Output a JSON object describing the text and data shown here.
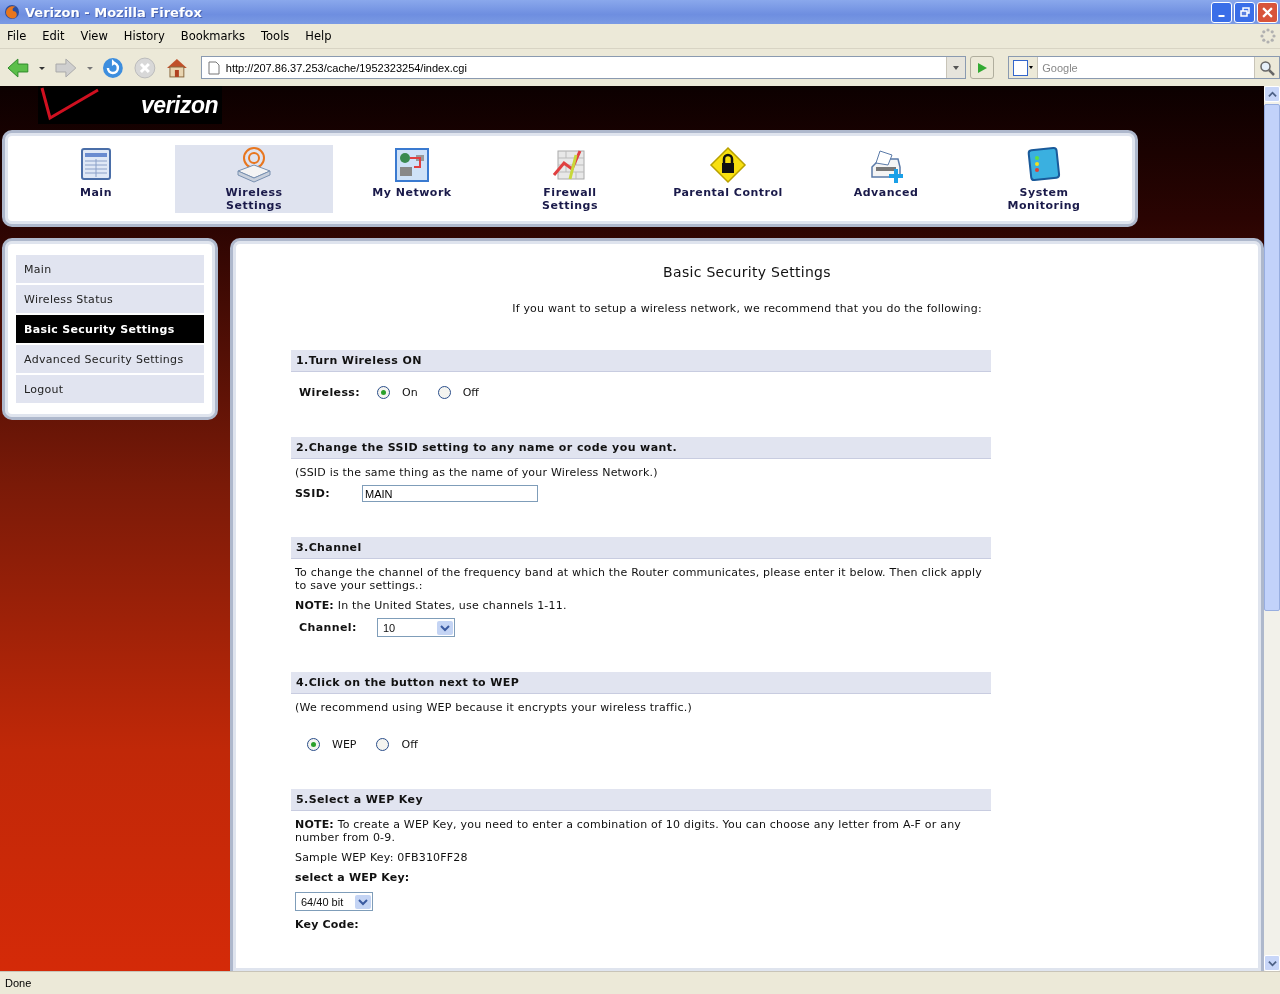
{
  "window": {
    "title": "Verizon - Mozilla Firefox"
  },
  "menu": [
    "File",
    "Edit",
    "View",
    "History",
    "Bookmarks",
    "Tools",
    "Help"
  ],
  "toolbar": {
    "url": "http://207.86.37.253/cache/1952323254/index.cgi",
    "search_placeholder": "Google"
  },
  "logo": {
    "text": "verizon"
  },
  "nav": [
    {
      "label": "Main",
      "selected": false
    },
    {
      "label": "Wireless Settings",
      "selected": true
    },
    {
      "label": "My Network",
      "selected": false
    },
    {
      "label": "Firewall Settings",
      "selected": false
    },
    {
      "label": "Parental Control",
      "selected": false
    },
    {
      "label": "Advanced",
      "selected": false
    },
    {
      "label": "System Monitoring",
      "selected": false
    }
  ],
  "sidebar": [
    {
      "label": "Main",
      "selected": false
    },
    {
      "label": "Wireless Status",
      "selected": false
    },
    {
      "label": "Basic Security Settings",
      "selected": true
    },
    {
      "label": "Advanced Security Settings",
      "selected": false
    },
    {
      "label": "Logout",
      "selected": false
    }
  ],
  "main": {
    "title": "Basic Security Settings",
    "intro": "If you want to setup a wireless network, we recommend that you do the following:",
    "sections": [
      {
        "heading": "1.Turn Wireless ON",
        "items": [
          {
            "kind": "radio_group",
            "label": "Wireless:",
            "options": [
              {
                "label": "On",
                "selected": true
              },
              {
                "label": "Off",
                "selected": false
              }
            ]
          }
        ]
      },
      {
        "heading": "2.Change the SSID setting to any name or code you want.",
        "items": [
          {
            "kind": "text",
            "text": "(SSID is the same thing as the name of your Wireless Network.)"
          },
          {
            "kind": "field",
            "label": "SSID:",
            "value": "MAIN"
          }
        ]
      },
      {
        "heading": "3.Channel",
        "items": [
          {
            "kind": "text",
            "text": "To change the channel of the frequency band at which the Router communicates, please enter it below. Then click apply to save your settings.:"
          },
          {
            "kind": "text",
            "text": "**NOTE:** In the United States, use channels 1-11."
          },
          {
            "kind": "select",
            "label": "Channel:",
            "value": "10"
          }
        ]
      },
      {
        "heading": "4.Click on the button next to WEP",
        "items": [
          {
            "kind": "text",
            "text": "(We recommend using WEP because it encrypts your wireless traffic.)"
          },
          {
            "kind": "radio_group",
            "options": [
              {
                "label": "WEP",
                "selected": true
              },
              {
                "label": "Off",
                "selected": false
              }
            ]
          }
        ]
      },
      {
        "heading": "5.Select a WEP Key",
        "items": [
          {
            "kind": "text",
            "text": "**NOTE:** To create a WEP Key, you need to enter a combination of 10 digits. You can choose any letter from A-F or any number from 0-9."
          },
          {
            "kind": "text",
            "text": "Sample WEP Key: 0FB310FF28"
          },
          {
            "kind": "text",
            "text": "**select a WEP Key:**"
          },
          {
            "kind": "select",
            "value": "64/40 bit"
          },
          {
            "kind": "text",
            "text": "**Key Code:**"
          }
        ]
      }
    ]
  },
  "status_bar": {
    "text": "Done"
  }
}
